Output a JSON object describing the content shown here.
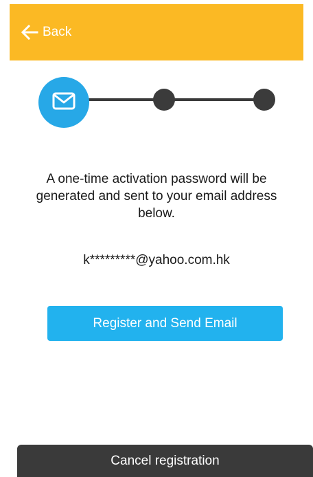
{
  "header": {
    "back_label": "Back",
    "background_color": "#fbb924",
    "back_icon": "arrow-left-icon"
  },
  "stepper": {
    "total_steps": 3,
    "current_step": 1,
    "active_color": "#27a8e7",
    "inactive_color": "#3b3b3b",
    "active_icon": "envelope-icon"
  },
  "content": {
    "message": "A one-time activation password will be generated and sent to your email address below.",
    "email": "k*********@yahoo.com.hk"
  },
  "actions": {
    "register_label": "Register and Send Email",
    "register_color": "#22b2ee",
    "cancel_label": "Cancel registration",
    "cancel_color": "#3a3a3a"
  }
}
